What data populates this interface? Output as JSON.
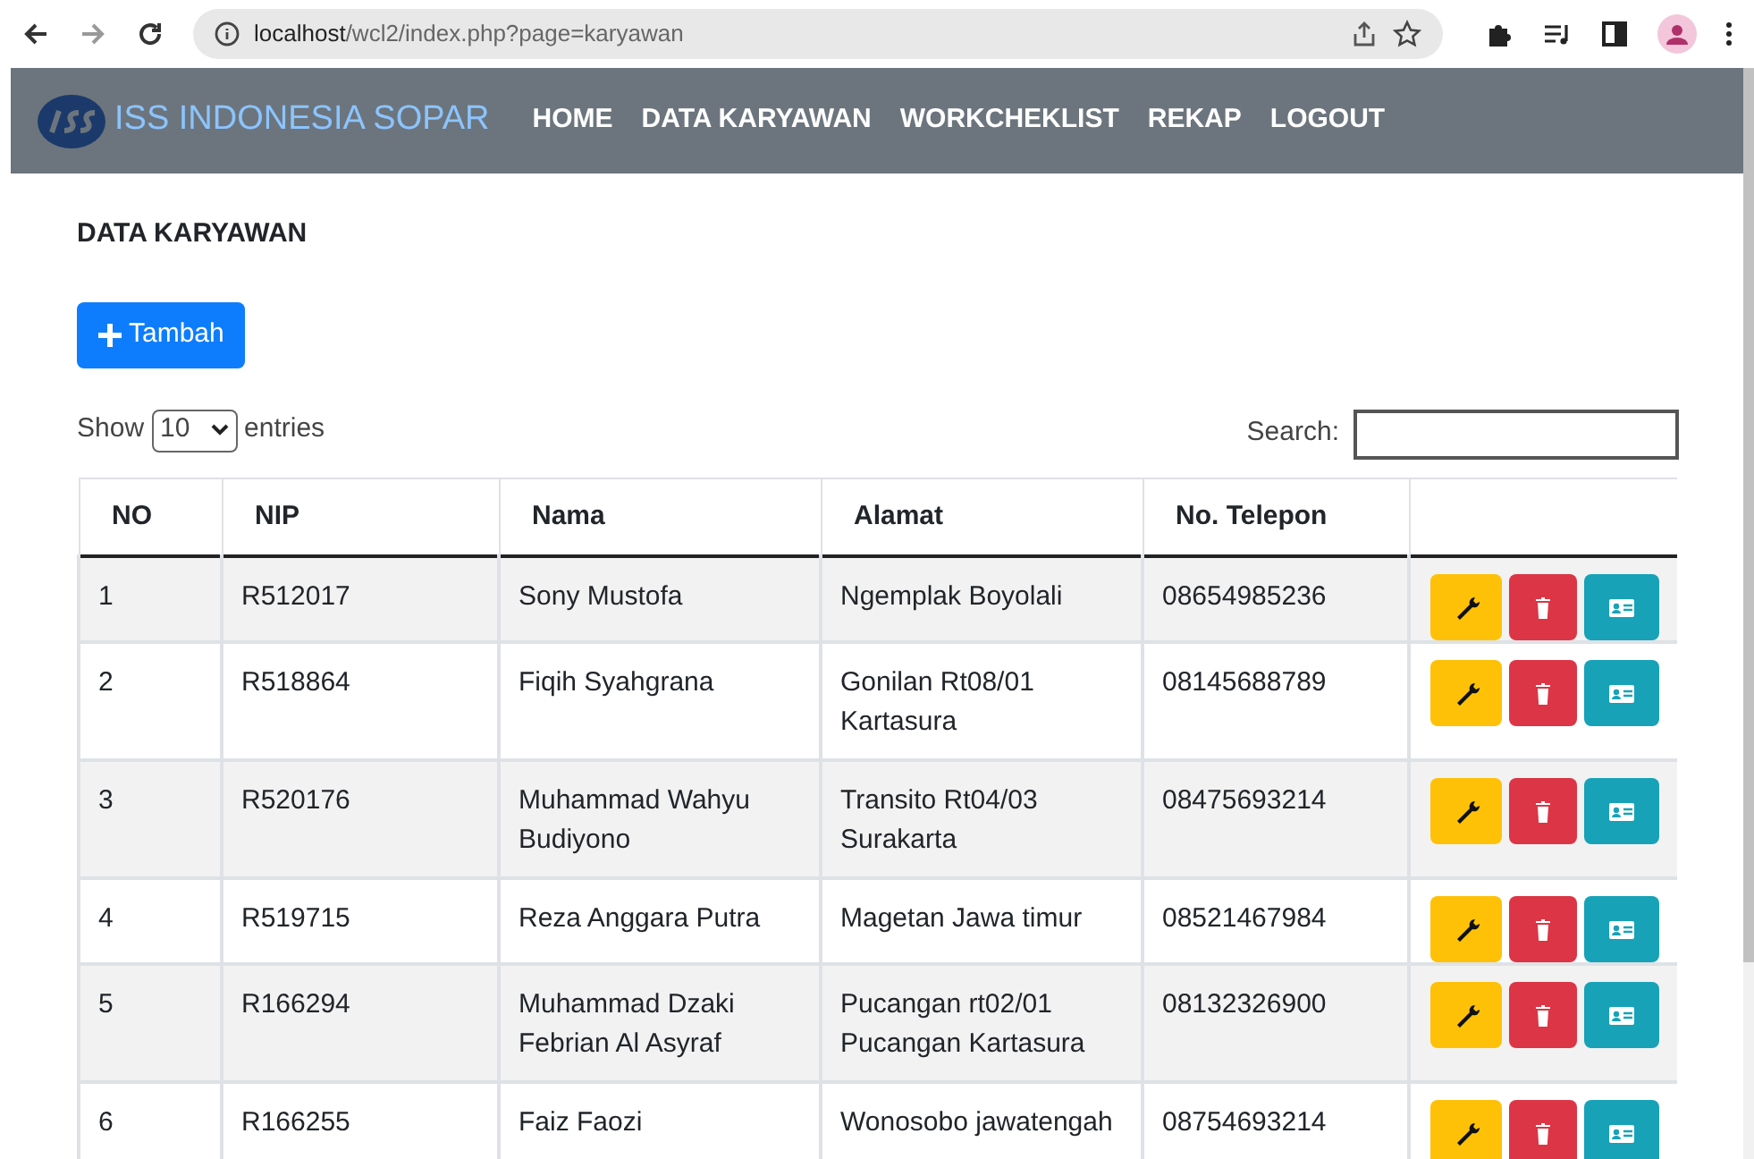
{
  "browser": {
    "url_host": "localhost",
    "url_path": "/wcl2/index.php?page=karyawan"
  },
  "navbar": {
    "brand": "ISS INDONESIA SOPAR",
    "links": [
      "HOME",
      "DATA KARYAWAN",
      "WORKCHEKLIST",
      "REKAP",
      "LOGOUT"
    ]
  },
  "page_title": "DATA KARYAWAN",
  "add_button": "Tambah",
  "length": {
    "before": "Show",
    "value": "10",
    "after": "entries"
  },
  "search": {
    "label": "Search:"
  },
  "table": {
    "columns": [
      "NO",
      "NIP",
      "Nama",
      "Alamat",
      "No. Telepon"
    ],
    "rows": [
      {
        "no": "1",
        "nip": "R512017",
        "nama": "Sony Mustofa",
        "alamat": "Ngemplak Boyolali",
        "telepon": "08654985236"
      },
      {
        "no": "2",
        "nip": "R518864",
        "nama": "Fiqih Syahgrana",
        "alamat": "Gonilan Rt08/01 Kartasura",
        "telepon": "08145688789"
      },
      {
        "no": "3",
        "nip": "R520176",
        "nama": "Muhammad Wahyu Budiyono",
        "alamat": "Transito Rt04/03 Surakarta",
        "telepon": "08475693214"
      },
      {
        "no": "4",
        "nip": "R519715",
        "nama": "Reza Anggara Putra",
        "alamat": "Magetan Jawa timur",
        "telepon": "08521467984"
      },
      {
        "no": "5",
        "nip": "R166294",
        "nama": "Muhammad Dzaki Febrian Al Asyraf",
        "alamat": "Pucangan rt02/01 Pucangan Kartasura",
        "telepon": "08132326900"
      },
      {
        "no": "6",
        "nip": "R166255",
        "nama": "Faiz Faozi",
        "alamat": "Wonosobo jawatengah",
        "telepon": "08754693214"
      }
    ]
  }
}
